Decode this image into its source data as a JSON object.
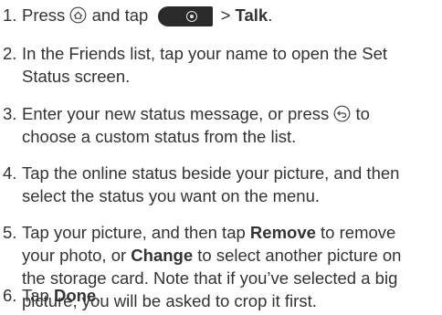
{
  "steps": [
    {
      "number": "1.",
      "text_a": "Press ",
      "text_b": " and tap ",
      "text_c": " > ",
      "bold": "Talk",
      "text_d": "."
    },
    {
      "number": "2.",
      "line1": "In the Friends list, tap your name to open the Set",
      "line2": "Status screen."
    },
    {
      "number": "3.",
      "line1_a": "Enter your new status message, or press ",
      "line1_b": " to",
      "line2": "choose a custom status from the list."
    },
    {
      "number": "4.",
      "line1": "Tap the online status beside your picture, and then",
      "line2": "select the status you want on the menu."
    },
    {
      "number": "5.",
      "line1_a": "Tap your picture, and then tap ",
      "line1_bold": "Remove",
      "line1_b": " to remove",
      "line2_a": "your photo, or ",
      "line2_bold": "Change",
      "line2_b": " to select another picture on",
      "line3": "the storage card. Note that if you’ve selected a big",
      "line4": "picture, you will be asked to crop it first."
    },
    {
      "number": "6.",
      "text_a": "Tap ",
      "bold": "Done",
      "text_b": "."
    }
  ],
  "icons": {
    "home": "home-key-icon",
    "app_button": "all-apps-button-icon",
    "back": "back-key-icon"
  }
}
